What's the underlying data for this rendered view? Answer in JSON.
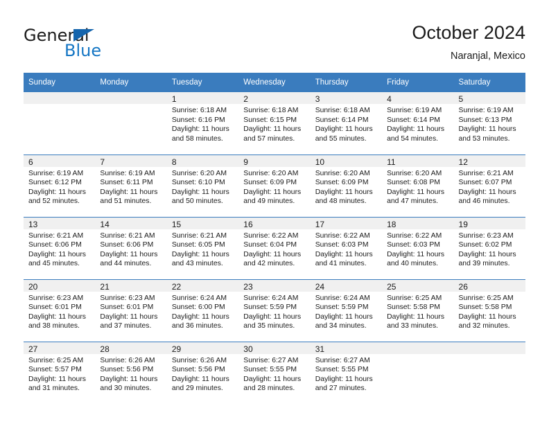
{
  "brand": {
    "name_top": "General",
    "name_bottom": "Blue",
    "accent_color": "#1576c4",
    "triangle_color": "#1565ad"
  },
  "header": {
    "title": "October 2024",
    "subtitle": "Naranjal, Mexico"
  },
  "calendar": {
    "header_bg": "#3a7cbe",
    "daynum_bg": "#f0f0f0",
    "weekday_headers": [
      "Sunday",
      "Monday",
      "Tuesday",
      "Wednesday",
      "Thursday",
      "Friday",
      "Saturday"
    ],
    "weeks": [
      [
        {
          "day": "",
          "sunrise": "",
          "sunset": "",
          "daylight1": "",
          "daylight2": ""
        },
        {
          "day": "",
          "sunrise": "",
          "sunset": "",
          "daylight1": "",
          "daylight2": ""
        },
        {
          "day": "1",
          "sunrise": "Sunrise: 6:18 AM",
          "sunset": "Sunset: 6:16 PM",
          "daylight1": "Daylight: 11 hours",
          "daylight2": "and 58 minutes."
        },
        {
          "day": "2",
          "sunrise": "Sunrise: 6:18 AM",
          "sunset": "Sunset: 6:15 PM",
          "daylight1": "Daylight: 11 hours",
          "daylight2": "and 57 minutes."
        },
        {
          "day": "3",
          "sunrise": "Sunrise: 6:18 AM",
          "sunset": "Sunset: 6:14 PM",
          "daylight1": "Daylight: 11 hours",
          "daylight2": "and 55 minutes."
        },
        {
          "day": "4",
          "sunrise": "Sunrise: 6:19 AM",
          "sunset": "Sunset: 6:14 PM",
          "daylight1": "Daylight: 11 hours",
          "daylight2": "and 54 minutes."
        },
        {
          "day": "5",
          "sunrise": "Sunrise: 6:19 AM",
          "sunset": "Sunset: 6:13 PM",
          "daylight1": "Daylight: 11 hours",
          "daylight2": "and 53 minutes."
        }
      ],
      [
        {
          "day": "6",
          "sunrise": "Sunrise: 6:19 AM",
          "sunset": "Sunset: 6:12 PM",
          "daylight1": "Daylight: 11 hours",
          "daylight2": "and 52 minutes."
        },
        {
          "day": "7",
          "sunrise": "Sunrise: 6:19 AM",
          "sunset": "Sunset: 6:11 PM",
          "daylight1": "Daylight: 11 hours",
          "daylight2": "and 51 minutes."
        },
        {
          "day": "8",
          "sunrise": "Sunrise: 6:20 AM",
          "sunset": "Sunset: 6:10 PM",
          "daylight1": "Daylight: 11 hours",
          "daylight2": "and 50 minutes."
        },
        {
          "day": "9",
          "sunrise": "Sunrise: 6:20 AM",
          "sunset": "Sunset: 6:09 PM",
          "daylight1": "Daylight: 11 hours",
          "daylight2": "and 49 minutes."
        },
        {
          "day": "10",
          "sunrise": "Sunrise: 6:20 AM",
          "sunset": "Sunset: 6:09 PM",
          "daylight1": "Daylight: 11 hours",
          "daylight2": "and 48 minutes."
        },
        {
          "day": "11",
          "sunrise": "Sunrise: 6:20 AM",
          "sunset": "Sunset: 6:08 PM",
          "daylight1": "Daylight: 11 hours",
          "daylight2": "and 47 minutes."
        },
        {
          "day": "12",
          "sunrise": "Sunrise: 6:21 AM",
          "sunset": "Sunset: 6:07 PM",
          "daylight1": "Daylight: 11 hours",
          "daylight2": "and 46 minutes."
        }
      ],
      [
        {
          "day": "13",
          "sunrise": "Sunrise: 6:21 AM",
          "sunset": "Sunset: 6:06 PM",
          "daylight1": "Daylight: 11 hours",
          "daylight2": "and 45 minutes."
        },
        {
          "day": "14",
          "sunrise": "Sunrise: 6:21 AM",
          "sunset": "Sunset: 6:06 PM",
          "daylight1": "Daylight: 11 hours",
          "daylight2": "and 44 minutes."
        },
        {
          "day": "15",
          "sunrise": "Sunrise: 6:21 AM",
          "sunset": "Sunset: 6:05 PM",
          "daylight1": "Daylight: 11 hours",
          "daylight2": "and 43 minutes."
        },
        {
          "day": "16",
          "sunrise": "Sunrise: 6:22 AM",
          "sunset": "Sunset: 6:04 PM",
          "daylight1": "Daylight: 11 hours",
          "daylight2": "and 42 minutes."
        },
        {
          "day": "17",
          "sunrise": "Sunrise: 6:22 AM",
          "sunset": "Sunset: 6:03 PM",
          "daylight1": "Daylight: 11 hours",
          "daylight2": "and 41 minutes."
        },
        {
          "day": "18",
          "sunrise": "Sunrise: 6:22 AM",
          "sunset": "Sunset: 6:03 PM",
          "daylight1": "Daylight: 11 hours",
          "daylight2": "and 40 minutes."
        },
        {
          "day": "19",
          "sunrise": "Sunrise: 6:23 AM",
          "sunset": "Sunset: 6:02 PM",
          "daylight1": "Daylight: 11 hours",
          "daylight2": "and 39 minutes."
        }
      ],
      [
        {
          "day": "20",
          "sunrise": "Sunrise: 6:23 AM",
          "sunset": "Sunset: 6:01 PM",
          "daylight1": "Daylight: 11 hours",
          "daylight2": "and 38 minutes."
        },
        {
          "day": "21",
          "sunrise": "Sunrise: 6:23 AM",
          "sunset": "Sunset: 6:01 PM",
          "daylight1": "Daylight: 11 hours",
          "daylight2": "and 37 minutes."
        },
        {
          "day": "22",
          "sunrise": "Sunrise: 6:24 AM",
          "sunset": "Sunset: 6:00 PM",
          "daylight1": "Daylight: 11 hours",
          "daylight2": "and 36 minutes."
        },
        {
          "day": "23",
          "sunrise": "Sunrise: 6:24 AM",
          "sunset": "Sunset: 5:59 PM",
          "daylight1": "Daylight: 11 hours",
          "daylight2": "and 35 minutes."
        },
        {
          "day": "24",
          "sunrise": "Sunrise: 6:24 AM",
          "sunset": "Sunset: 5:59 PM",
          "daylight1": "Daylight: 11 hours",
          "daylight2": "and 34 minutes."
        },
        {
          "day": "25",
          "sunrise": "Sunrise: 6:25 AM",
          "sunset": "Sunset: 5:58 PM",
          "daylight1": "Daylight: 11 hours",
          "daylight2": "and 33 minutes."
        },
        {
          "day": "26",
          "sunrise": "Sunrise: 6:25 AM",
          "sunset": "Sunset: 5:58 PM",
          "daylight1": "Daylight: 11 hours",
          "daylight2": "and 32 minutes."
        }
      ],
      [
        {
          "day": "27",
          "sunrise": "Sunrise: 6:25 AM",
          "sunset": "Sunset: 5:57 PM",
          "daylight1": "Daylight: 11 hours",
          "daylight2": "and 31 minutes."
        },
        {
          "day": "28",
          "sunrise": "Sunrise: 6:26 AM",
          "sunset": "Sunset: 5:56 PM",
          "daylight1": "Daylight: 11 hours",
          "daylight2": "and 30 minutes."
        },
        {
          "day": "29",
          "sunrise": "Sunrise: 6:26 AM",
          "sunset": "Sunset: 5:56 PM",
          "daylight1": "Daylight: 11 hours",
          "daylight2": "and 29 minutes."
        },
        {
          "day": "30",
          "sunrise": "Sunrise: 6:27 AM",
          "sunset": "Sunset: 5:55 PM",
          "daylight1": "Daylight: 11 hours",
          "daylight2": "and 28 minutes."
        },
        {
          "day": "31",
          "sunrise": "Sunrise: 6:27 AM",
          "sunset": "Sunset: 5:55 PM",
          "daylight1": "Daylight: 11 hours",
          "daylight2": "and 27 minutes."
        },
        {
          "day": "",
          "sunrise": "",
          "sunset": "",
          "daylight1": "",
          "daylight2": ""
        },
        {
          "day": "",
          "sunrise": "",
          "sunset": "",
          "daylight1": "",
          "daylight2": ""
        }
      ]
    ]
  }
}
